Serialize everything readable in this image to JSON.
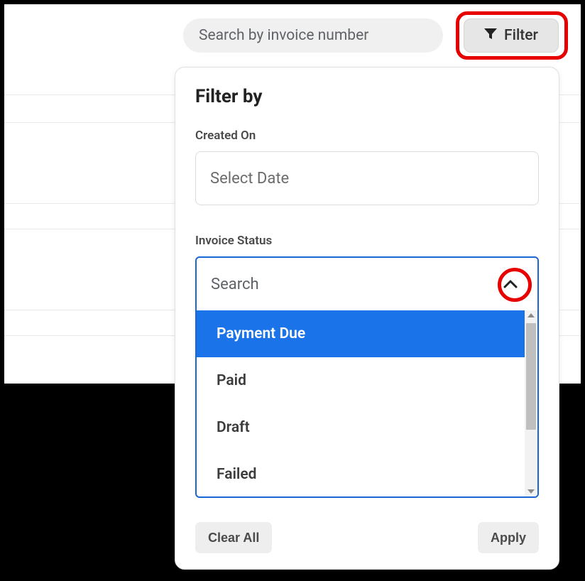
{
  "search": {
    "placeholder": "Search by invoice number"
  },
  "filterButton": {
    "label": "Filter"
  },
  "panel": {
    "title": "Filter by",
    "createdOn": {
      "label": "Created On",
      "placeholder": "Select Date"
    },
    "invoiceStatus": {
      "label": "Invoice Status",
      "searchPlaceholder": "Search",
      "options": [
        "Payment Due",
        "Paid",
        "Draft",
        "Failed"
      ],
      "selectedIndex": 0
    },
    "actions": {
      "clear": "Clear All",
      "apply": "Apply"
    }
  }
}
